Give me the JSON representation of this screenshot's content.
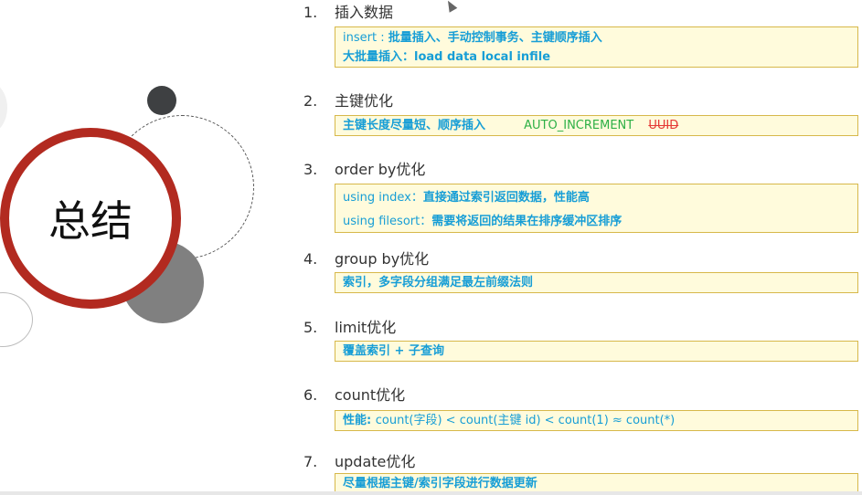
{
  "slide_title": "总结",
  "items": [
    {
      "num": "1.",
      "title": "插入数据",
      "lines": [
        {
          "prefix": "insert : ",
          "text": "批量插入、手动控制事务、主键顺序插入"
        },
        {
          "prefix": "",
          "text": "大批量插入：load  data  local  infile"
        }
      ]
    },
    {
      "num": "2.",
      "title": "主键优化",
      "text": "主键长度尽量短、顺序插入",
      "green": "AUTO_INCREMENT",
      "struck": "UUID"
    },
    {
      "num": "3.",
      "title": "order by优化",
      "lines": [
        {
          "prefix": "using index：",
          "text": "直接通过索引返回数据，性能高"
        },
        {
          "prefix": "using filesort：",
          "text": "需要将返回的结果在排序缓冲区排序"
        }
      ]
    },
    {
      "num": "4.",
      "title": "group by优化",
      "text": "索引，多字段分组满足最左前缀法则"
    },
    {
      "num": "5.",
      "title": "limit优化",
      "text": "覆盖索引 + 子查询"
    },
    {
      "num": "6.",
      "title": "count优化",
      "prefix": "性能: ",
      "text": "count(字段) < count(主键 id) < count(1) ≈ count(*)"
    },
    {
      "num": "7.",
      "title": "update优化",
      "text": "尽量根据主键/索引字段进行数据更新"
    }
  ],
  "colors": {
    "accent_red": "#b22a20",
    "text_blue": "#179ed6",
    "highlight_green": "#2db046",
    "box_fill": "#fffbdc"
  }
}
